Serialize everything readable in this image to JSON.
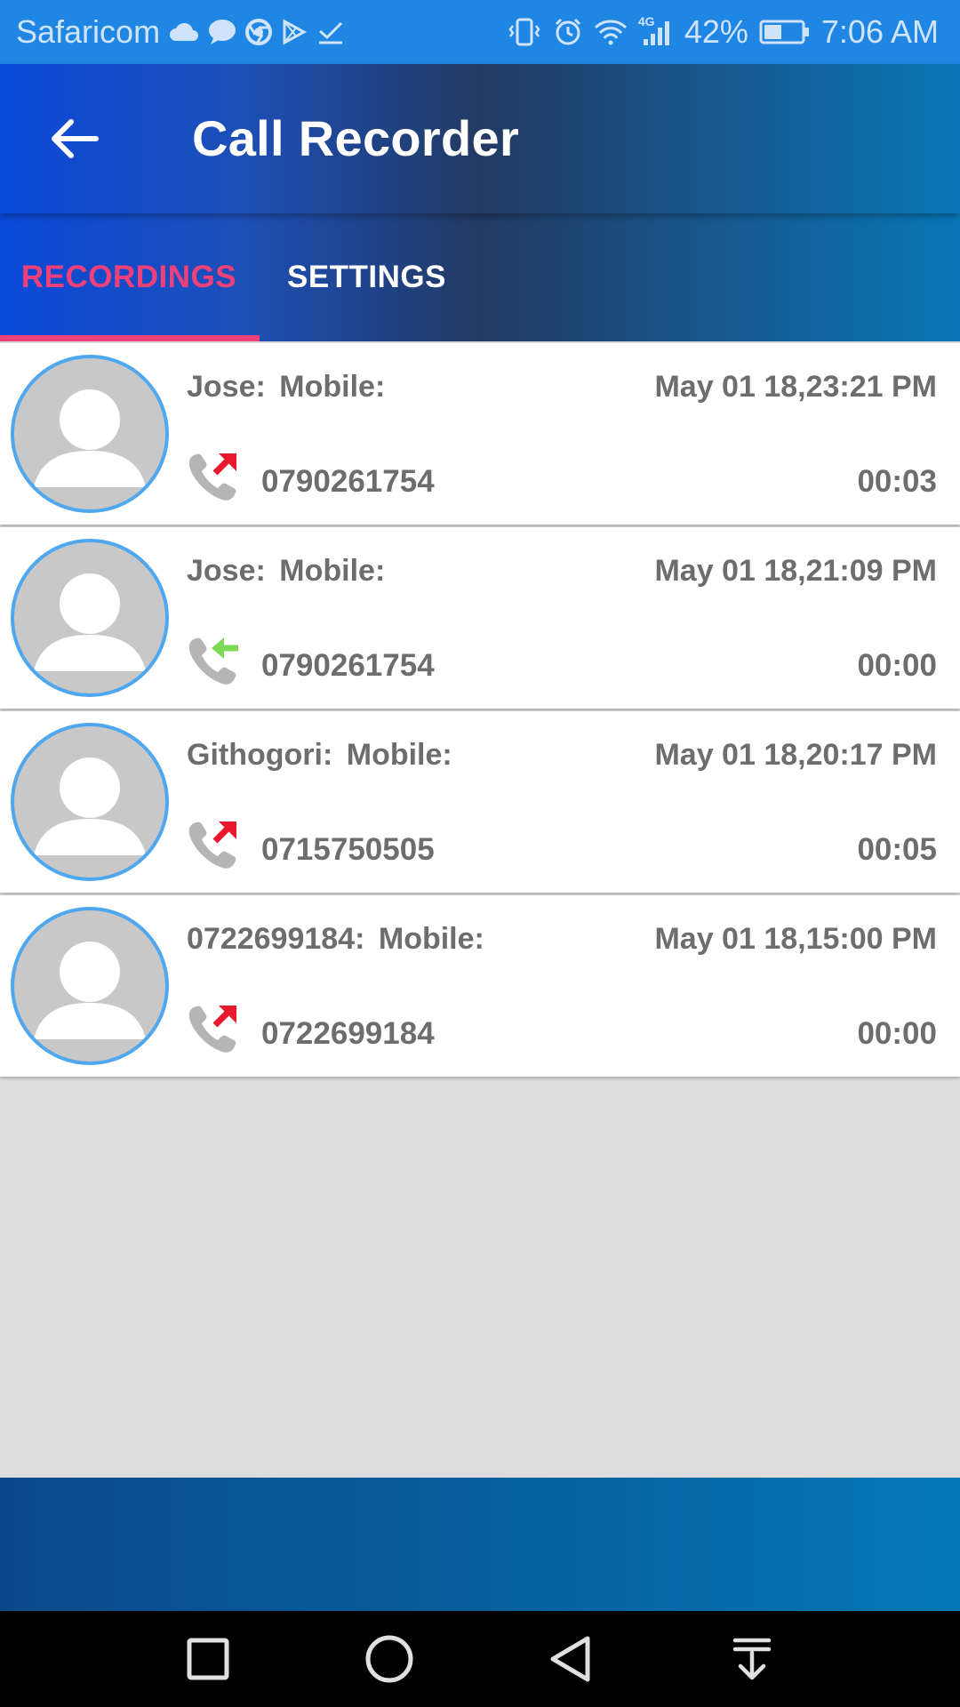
{
  "status_bar": {
    "carrier": "Safaricom",
    "network": "4G",
    "battery": "42%",
    "time": "7:06 AM"
  },
  "app_bar": {
    "title": "Call Recorder"
  },
  "tabs": [
    {
      "label": "RECORDINGS",
      "active": true
    },
    {
      "label": "SETTINGS",
      "active": false
    }
  ],
  "colors": {
    "accent": "#f0407a",
    "avatar_ring": "#4ea7ef",
    "outgoing_arrow": "#e8192c",
    "incoming_arrow": "#7ed957"
  },
  "recordings": [
    {
      "name": "Jose:",
      "type": "Mobile:",
      "datetime": "May 01 18,23:21 PM",
      "number": "0790261754",
      "duration": "00:03",
      "direction": "outgoing"
    },
    {
      "name": "Jose:",
      "type": "Mobile:",
      "datetime": "May 01 18,21:09 PM",
      "number": "0790261754",
      "duration": "00:00",
      "direction": "incoming"
    },
    {
      "name": "Githogori:",
      "type": "Mobile:",
      "datetime": "May 01 18,20:17 PM",
      "number": "0715750505",
      "duration": "00:05",
      "direction": "outgoing"
    },
    {
      "name": "0722699184:",
      "type": "Mobile:",
      "datetime": "May 01 18,15:00 PM",
      "number": "0722699184",
      "duration": "00:00",
      "direction": "outgoing"
    }
  ],
  "nav_bar": {
    "icons": [
      "recents-square-icon",
      "home-circle-icon",
      "back-triangle-icon",
      "notification-pull-down-icon"
    ]
  }
}
